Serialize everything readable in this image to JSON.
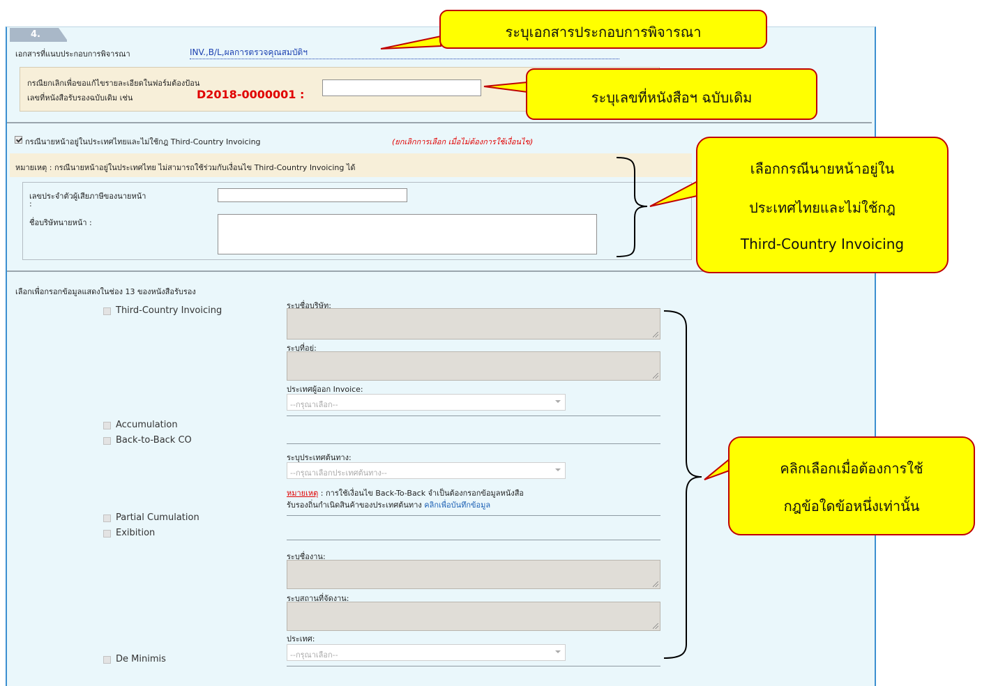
{
  "section": {
    "number": "4."
  },
  "attachments": {
    "label": "เอกสารที่แนบประกอบการพิจารณา",
    "value": "INV.,B/L,ผลการตรวจคุณสมบัติฯ"
  },
  "cancel_box": {
    "line1": "กรณียกเลิกเพื่อขอแก้ไขรายละเอียดในฟอร์มต้องป้อน",
    "line2": "เลขที่หนังสือรับรองฉบับเดิม เช่น",
    "example": "D2018-0000001 :"
  },
  "broker": {
    "checkbox_label": "กรณีนายหน้าอยู่ในประเทศไทยและไม่ใช้กฎ Third-Country Invoicing",
    "checkbox_hint": "(ยกเลิกการเลือก เมื่อไม่ต้องการใช้เงื่อนไข)",
    "note": "หมายเหตุ : กรณีนายหน้าอยู่ในประเทศไทย ไม่สามารถใช้ร่วมกับเงื่อนไข Third-Country Invoicing ได้",
    "tax_id_label": "เลขประจำตัวผู้เสียภาษีของนายหน้า",
    "tax_id_colon": ":",
    "company_label": "ชื่อบริษัทนายหน้า :"
  },
  "box13": {
    "heading": "เลือกเพื่อกรอกข้อมูลแสดงในช่อง 13 ของหนังสือรับรอง",
    "options": {
      "tci": "Third-Country Invoicing",
      "accumulation": "Accumulation",
      "back_to_back": "Back-to-Back CO",
      "partial": "Partial Cumulation",
      "exhibition": "Exibition",
      "de_minimis": "De Minimis"
    },
    "tci_company_label": "ระบุชื่อบริษัท:",
    "tci_address_label": "ระบุที่อยู่:",
    "tci_country_label": "ประเทศผู้ออก Invoice:",
    "tci_country_placeholder": "--กรุณาเลือก--",
    "btb_country_label": "ระบุประเทศต้นทาง:",
    "btb_country_placeholder": "--กรุณาเลือกประเทศต้นทาง--",
    "btb_note_prefix": "หมายเหตุ",
    "btb_note_text1": " : การใช้เงื่อนไข Back-To-Back จำเป็นต้องกรอกข้อมูลหนังสือ",
    "btb_note_text2": "รับรองถิ่นกำเนิดสินค้าของประเทศต้นทาง ",
    "btb_note_link": "คลิกเพื่อบันทึกข้อมูล",
    "exh_name_label": "ระบุชื่องาน:",
    "exh_venue_label": "ระบุสถานที่จัดงาน:",
    "exh_country_label": "ประเทศ:",
    "exh_country_placeholder": "--กรุณาเลือก--"
  },
  "callouts": {
    "c1": "ระบุเอกสารประกอบการพิจารณา",
    "c2": "ระบุเลขที่หนังสือฯ ฉบับเดิม",
    "c3_l1": "เลือกกรณีนายหน้าอยู่ใน",
    "c3_l2": "ประเทศไทยและไม่ใช้กฎ",
    "c3_l3": "Third-Country Invoicing",
    "c4_l1": "คลิกเลือกเมื่อต้องการใช้",
    "c4_l2": "กฎข้อใดข้อหนึ่งเท่านั้น"
  },
  "colors": {
    "panel_bg": "#eaf7fb",
    "callout_fill": "#ffff00",
    "callout_border": "#c00000",
    "accent_red": "#e00000",
    "link_blue": "#1a5fb4"
  }
}
